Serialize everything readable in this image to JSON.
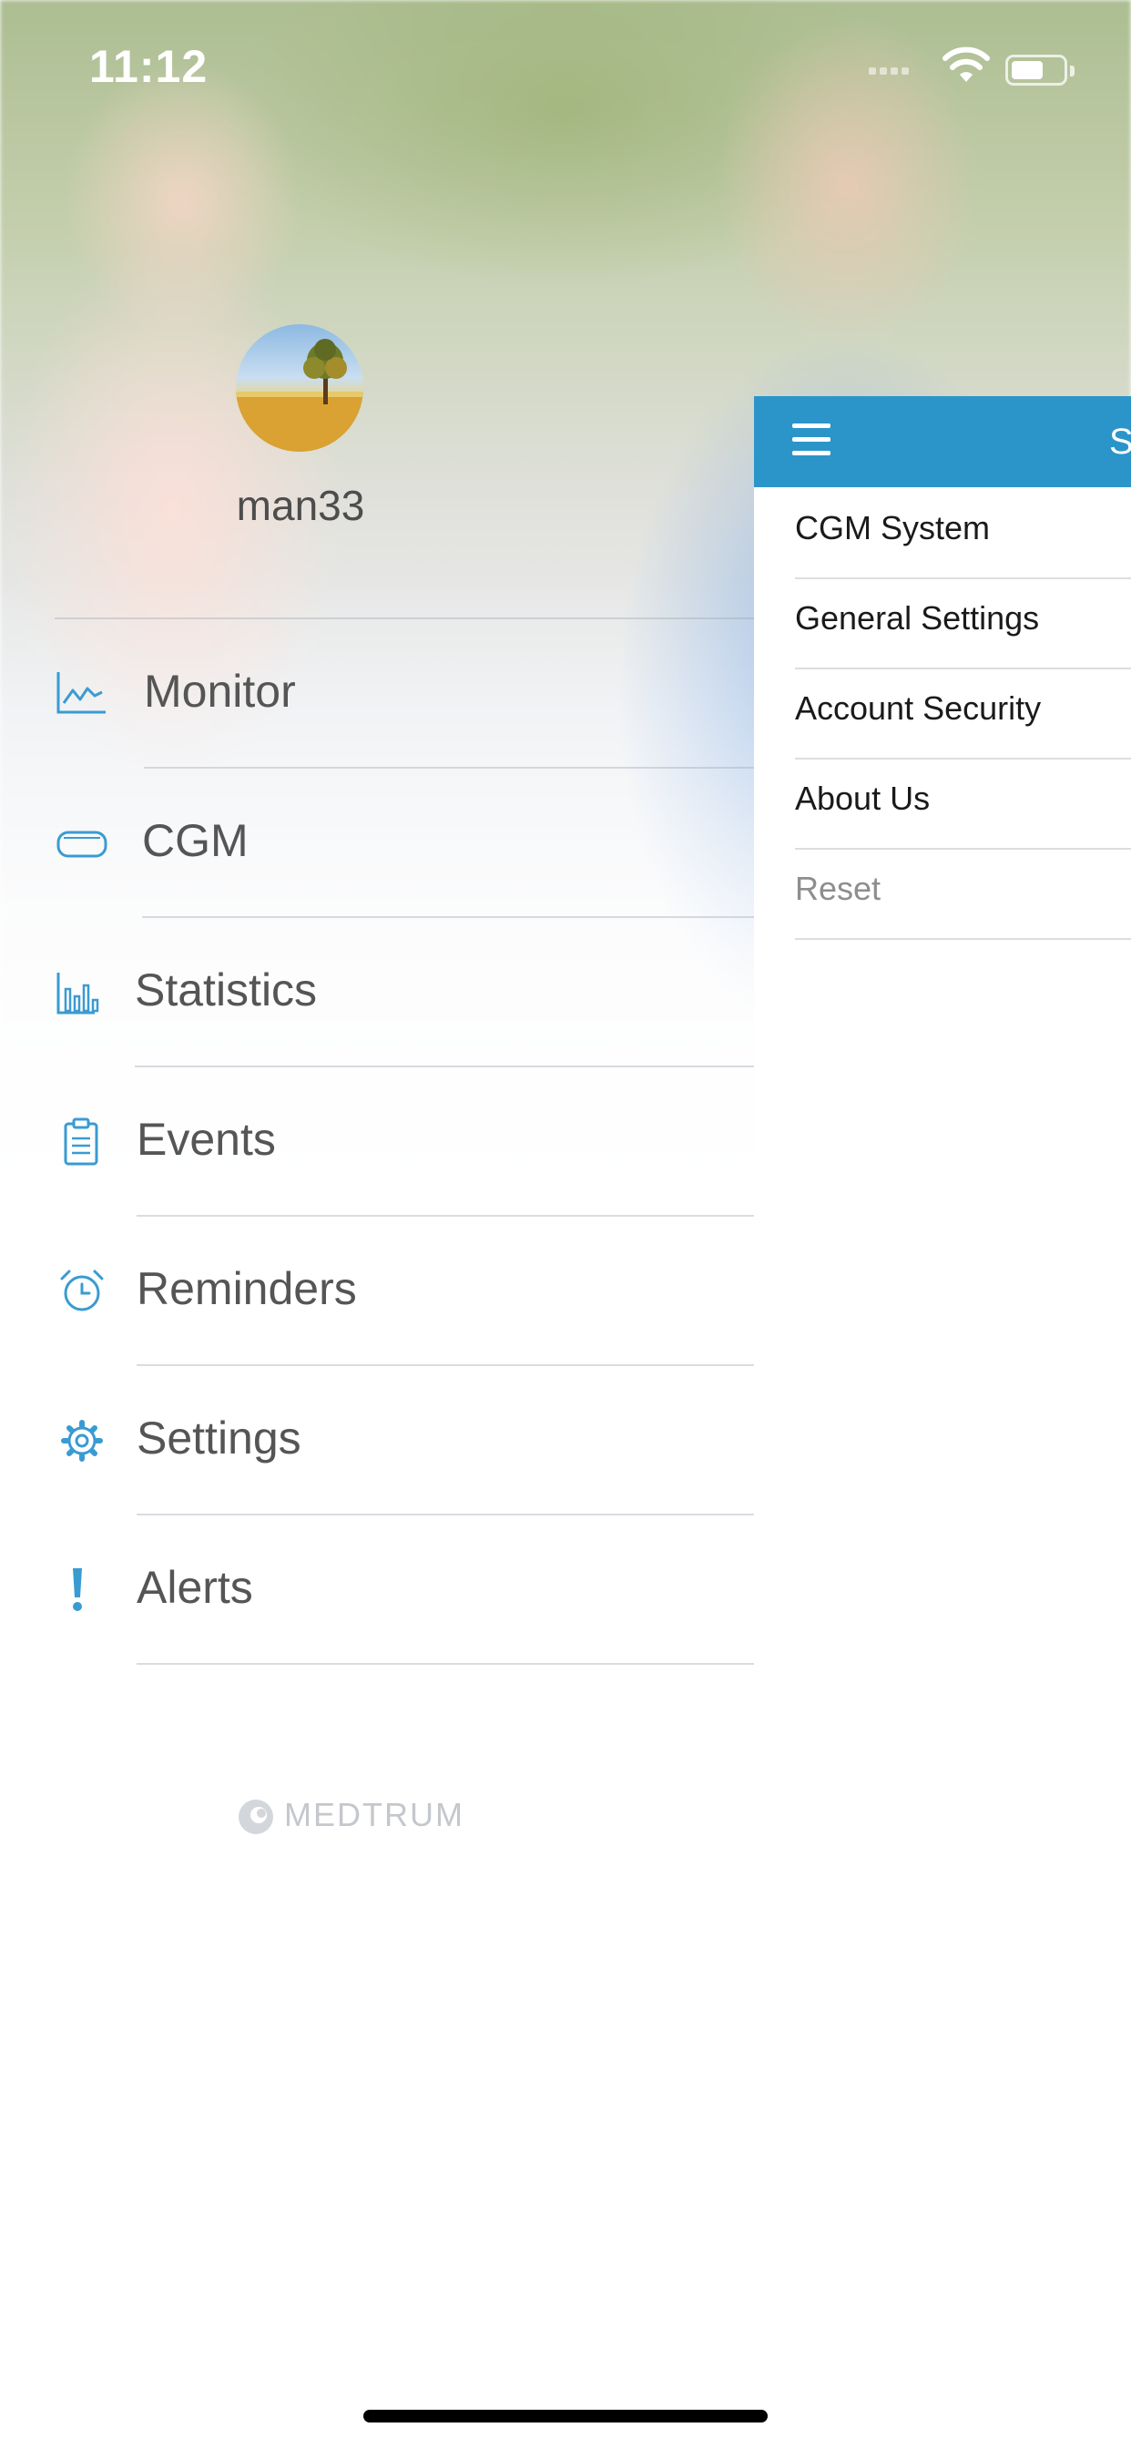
{
  "status_bar": {
    "time": "11:12"
  },
  "drawer": {
    "username": "man33",
    "menu": [
      {
        "label": "Monitor",
        "icon": "line-chart-icon"
      },
      {
        "label": "CGM",
        "icon": "cgm-device-icon"
      },
      {
        "label": "Statistics",
        "icon": "bar-chart-icon"
      },
      {
        "label": "Events",
        "icon": "clipboard-icon"
      },
      {
        "label": "Reminders",
        "icon": "alarm-clock-icon"
      },
      {
        "label": "Settings",
        "icon": "gear-icon"
      },
      {
        "label": "Alerts",
        "icon": "exclamation-icon"
      }
    ],
    "brand": "MEDTRUM"
  },
  "settings_panel": {
    "title": "S",
    "items": [
      {
        "label": "CGM System"
      },
      {
        "label": "General Settings"
      },
      {
        "label": "Account Security"
      },
      {
        "label": "About Us"
      },
      {
        "label": "Reset",
        "muted": true
      }
    ]
  },
  "colors": {
    "accent": "#2b95c9",
    "icon": "#3a9bd1",
    "menu_text": "#555555"
  }
}
